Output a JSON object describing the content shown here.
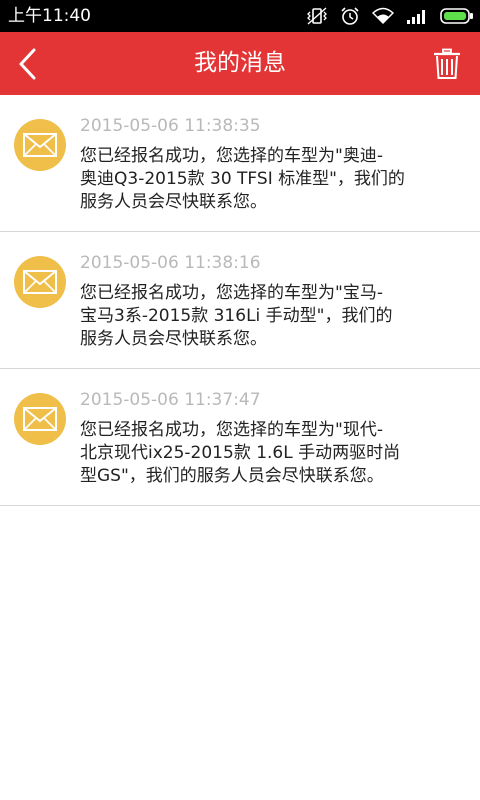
{
  "status": {
    "time": "上午11:40"
  },
  "header": {
    "title": "我的消息"
  },
  "messages": [
    {
      "time": "2015-05-06 11:38:35",
      "line1": "您已经报名成功，您选择的车型为\"奥迪-",
      "line2": "奥迪Q3-2015款 30 TFSI 标准型\"，我们的",
      "line3": "服务人员会尽快联系您。"
    },
    {
      "time": "2015-05-06 11:38:16",
      "line1": "您已经报名成功，您选择的车型为\"宝马-",
      "line2": "宝马3系-2015款 316Li 手动型\"，我们的",
      "line3": "服务人员会尽快联系您。"
    },
    {
      "time": "2015-05-06 11:37:47",
      "line1": "您已经报名成功，您选择的车型为\"现代-",
      "line2": "北京现代ix25-2015款 1.6L 手动两驱时尚",
      "line3": "型GS\"，我们的服务人员会尽快联系您。"
    }
  ],
  "icons": {
    "back": "chevron-left-icon",
    "trash": "trash-icon",
    "message": "envelope-icon"
  },
  "colors": {
    "header": "#e33535",
    "avatar": "#efbf4a",
    "timestamp": "#b9b9b9"
  }
}
